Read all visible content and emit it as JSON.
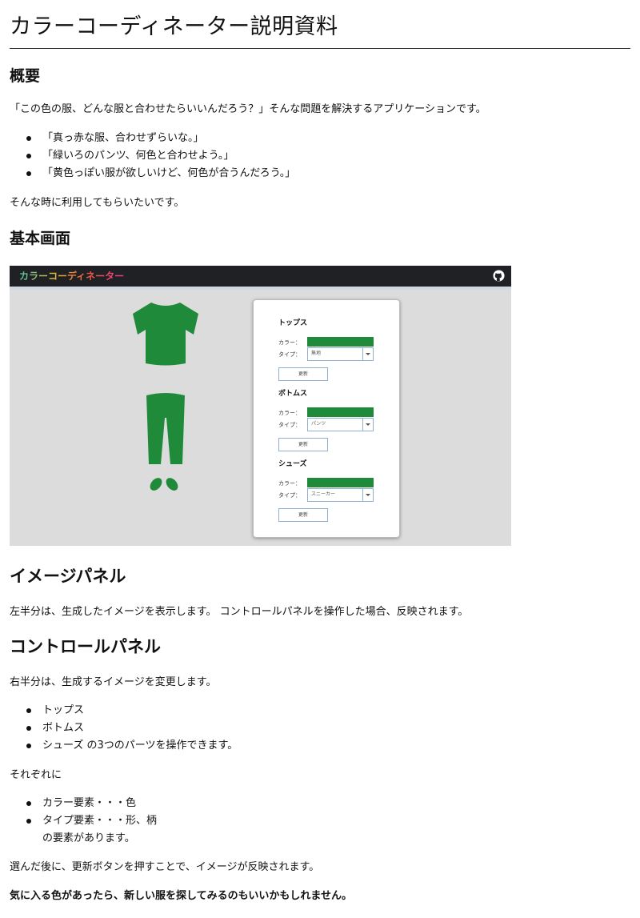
{
  "title": "カラーコーディネーター説明資料",
  "overview": {
    "heading": "概要",
    "intro": "「この色の服、どんな服と合わせたらいいんだろう？」そんな問題を解決するアプリケーションです。",
    "items": [
      "「真っ赤な服、合わせずらいな。」",
      "「緑いろのパンツ、何色と合わせよう。」",
      "「黄色っぽい服が欲しいけど、何色が合うんだろう。」"
    ],
    "closing": "そんな時に利用してもらいたいです。"
  },
  "basic": {
    "heading": "基本画面",
    "app": {
      "title": "カラーコーディネーター",
      "github_icon": "github-icon",
      "color_label": "カラー：",
      "type_label": "タイプ：",
      "update_label": "更新",
      "garment_color": "#1f8b3a",
      "sections": [
        {
          "name": "トップス",
          "type_value": "無地"
        },
        {
          "name": "ボトムス",
          "type_value": "パンツ"
        },
        {
          "name": "シューズ",
          "type_value": "スニーカー"
        }
      ]
    }
  },
  "image_panel": {
    "heading": "イメージパネル",
    "body": "左半分は、生成したイメージを表示します。 コントロールパネルを操作した場合、反映されます。"
  },
  "control_panel": {
    "heading": "コントロールパネル",
    "body": "右半分は、生成するイメージを変更します。",
    "parts": [
      "トップス",
      "ボトムス",
      "シューズ の3つのパーツを操作できます。"
    ],
    "each": "それぞれに",
    "elements": [
      "カラー要素・・・色",
      "タイプ要素・・・形、柄"
    ],
    "elements_tail": "の要素があります。",
    "update_note": "選んだ後に、更新ボタンを押すことで、イメージが反映されます。",
    "final_note": "気に入る色があったら、新しい服を探してみるのもいいかもしれません。"
  }
}
